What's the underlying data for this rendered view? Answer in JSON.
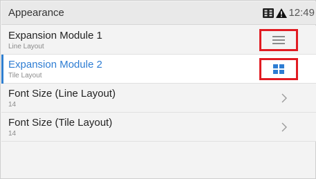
{
  "statusbar": {
    "title": "Appearance",
    "time": "12:49",
    "icons": [
      "expansion-module-icon",
      "warning-icon"
    ]
  },
  "rows": [
    {
      "label": "Expansion Module 1",
      "sub": "Line Layout",
      "control_icon": "line-layout-icon",
      "selected": false
    },
    {
      "label": "Expansion Module 2",
      "sub": "Tile Layout",
      "control_icon": "tile-layout-icon",
      "selected": true
    },
    {
      "label": "Font Size (Line Layout)",
      "sub": "14",
      "control_icon": "chevron-right-icon",
      "selected": false
    },
    {
      "label": "Font Size (Tile Layout)",
      "sub": "14",
      "control_icon": "chevron-right-icon",
      "selected": false
    }
  ],
  "colors": {
    "accent": "#2e7dd3",
    "highlight_box": "#e11b22",
    "background": "#f3f3f3"
  }
}
